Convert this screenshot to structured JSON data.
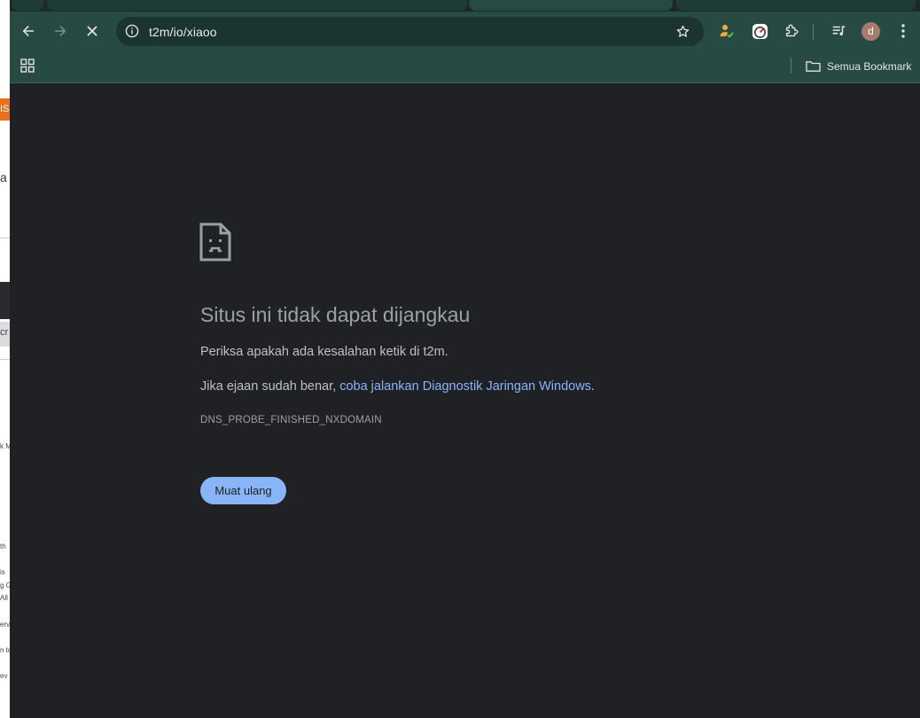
{
  "browser": {
    "url": "t2m/io/xiaoo",
    "profile_initial": "d"
  },
  "bookmarks": {
    "folder_label": "Semua Bookmark"
  },
  "error_page": {
    "title": "Situs ini tidak dapat dijangkau",
    "line1": "Periksa apakah ada kesalahan ketik di t2m.",
    "line2_prefix": "Jika ejaan sudah benar, ",
    "line2_link": "coba jalankan Diagnostik Jaringan Windows",
    "line2_suffix": ".",
    "error_code": "DNS_PROBE_FINISHED_NXDOMAIN",
    "reload_label": "Muat ulang"
  },
  "background_window": {
    "fragments": [
      "IS",
      "a",
      "cr",
      "k M",
      "th",
      "is",
      "g G",
      "All",
      "erv",
      "n to",
      "ev"
    ]
  },
  "colors": {
    "toolbar": "#274a43",
    "page_background": "#202124",
    "link": "#8ab4f8",
    "button": "#8ab4f8"
  }
}
